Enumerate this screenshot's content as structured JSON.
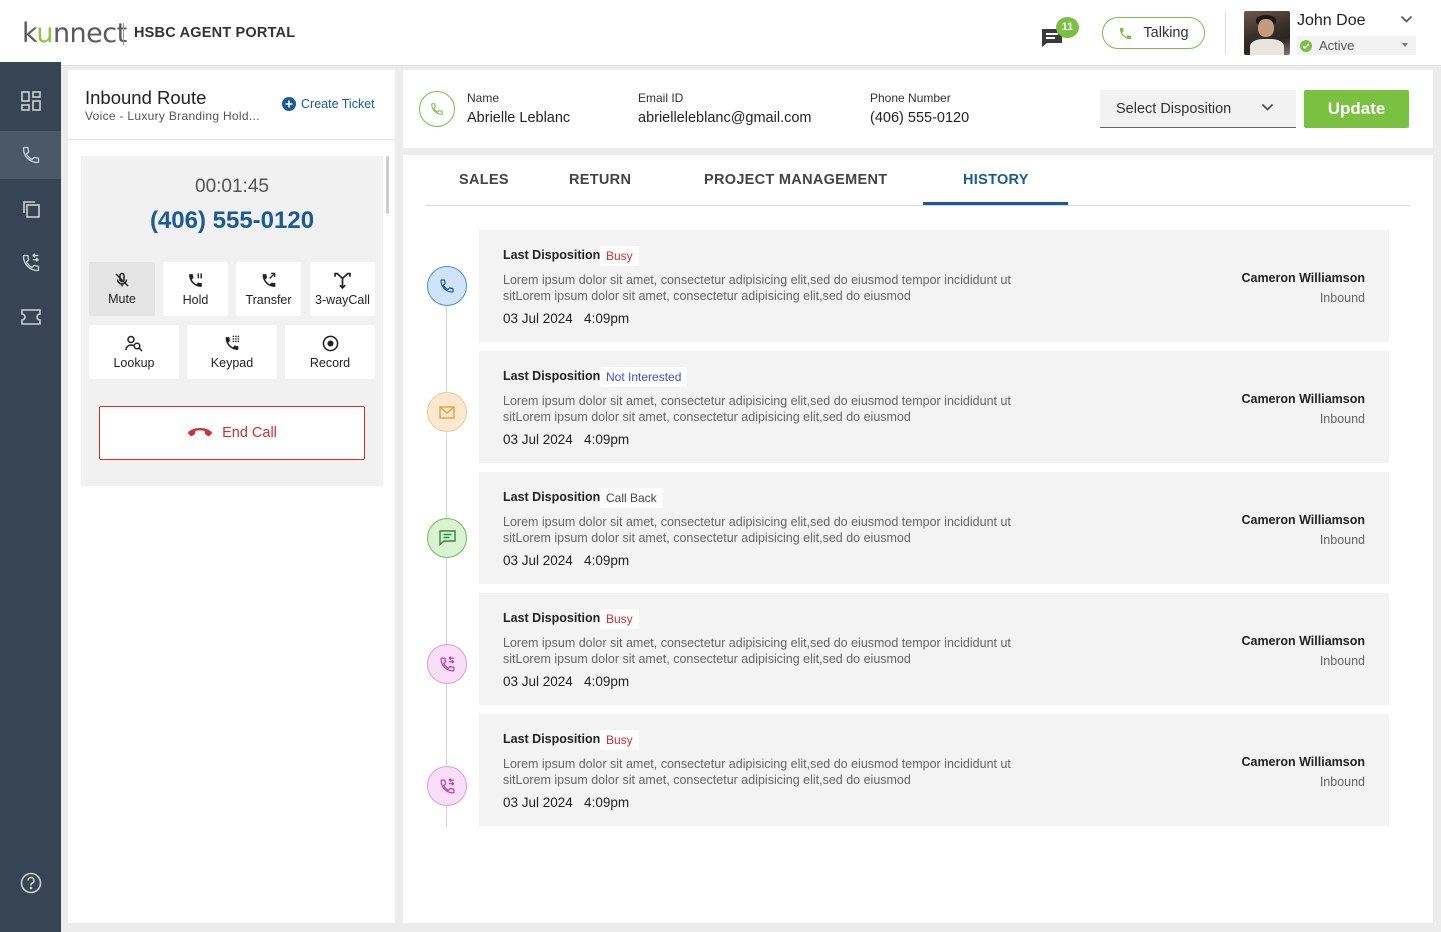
{
  "header": {
    "logo_pre": "k",
    "logo_u": "u",
    "logo_post": "nnect",
    "portal_title": "HSBC AGENT PORTAL",
    "chat_count": "11",
    "talking_label": "Talking",
    "user_name": "John Doe",
    "user_status": "Active"
  },
  "sidebar": {
    "items": [
      {
        "icon": "dashboard-icon"
      },
      {
        "icon": "phone-icon",
        "active": true
      },
      {
        "icon": "copy-icon"
      },
      {
        "icon": "call-transfer-icon"
      },
      {
        "icon": "ticket-icon"
      }
    ],
    "help_icon": "help-icon"
  },
  "left_panel": {
    "route_title": "Inbound Route",
    "route_subtitle": "Voice - Luxury Branding Hold...",
    "create_ticket": "Create Ticket",
    "timer": "00:01:45",
    "phone_number": "(406) 555-0120",
    "controls": {
      "mute": "Mute",
      "hold": "Hold",
      "transfer": "Transfer",
      "three_way": "3-wayCall",
      "lookup": "Lookup",
      "keypad": "Keypad",
      "record": "Record"
    },
    "end_call": "End Call"
  },
  "contact": {
    "name_label": "Name",
    "name": "Abrielle Leblanc",
    "email_label": "Email ID",
    "email": "abrielleleblanc@gmail.com",
    "phone_label": "Phone Number",
    "phone": "(406) 555-0120",
    "disposition_placeholder": "Select Disposition",
    "update_label": "Update"
  },
  "tabs": [
    "SALES",
    "RETURN",
    "PROJECT MANAGEMENT",
    "HISTORY"
  ],
  "active_tab": "HISTORY",
  "colors": {
    "accent_green": "#7ac142",
    "brand_blue": "#1a5a99",
    "busy_red": "#d62e2e",
    "sidebar_bg": "#374453"
  },
  "history": [
    {
      "label": "Last Disposition:",
      "disposition": "Busy",
      "disposition_color": "#d62e2e",
      "text": "Lorem ipsum dolor sit amet, consectetur adipisicing elit,sed do eiusmod tempor incididunt ut sitLorem ipsum dolor sit amet, consectetur adipisicing elit,sed do eiusmod",
      "date": "03 Jul 2024   4:09pm",
      "agent": "Cameron Williamson",
      "direction": "Inbound",
      "icon": "phone-icon"
    },
    {
      "label": "Last Disposition:",
      "disposition": "Not Interested",
      "disposition_color": "#3b4fd0",
      "text": "Lorem ipsum dolor sit amet, consectetur adipisicing elit,sed do eiusmod tempor incididunt ut sitLorem ipsum dolor sit amet, consectetur adipisicing elit,sed do eiusmod",
      "date": "03 Jul 2024   4:09pm",
      "agent": "Cameron Williamson",
      "direction": "Inbound",
      "icon": "mail-icon"
    },
    {
      "label": "Last Disposition:",
      "disposition": "Call Back",
      "disposition_color": "#444444",
      "text": "Lorem ipsum dolor sit amet, consectetur adipisicing elit,sed do eiusmod tempor incididunt ut sitLorem ipsum dolor sit amet, consectetur adipisicing elit,sed do eiusmod",
      "date": "03 Jul 2024   4:09pm",
      "agent": "Cameron Williamson",
      "direction": "Inbound",
      "icon": "chat-icon"
    },
    {
      "label": "Last Disposition:",
      "disposition": "Busy",
      "disposition_color": "#d62e2e",
      "text": "Lorem ipsum dolor sit amet, consectetur adipisicing elit,sed do eiusmod tempor incididunt ut sitLorem ipsum dolor sit amet, consectetur adipisicing elit,sed do eiusmod",
      "date": "03 Jul 2024   4:09pm",
      "agent": "Cameron Williamson",
      "direction": "Inbound",
      "icon": "call-transfer-icon"
    },
    {
      "label": "Last Disposition:",
      "disposition": "Busy",
      "disposition_color": "#d62e2e",
      "text": "Lorem ipsum dolor sit amet, consectetur adipisicing elit,sed do eiusmod tempor incididunt ut sitLorem ipsum dolor sit amet, consectetur adipisicing elit,sed do eiusmod",
      "date": "03 Jul 2024   4:09pm",
      "agent": "Cameron Williamson",
      "direction": "Inbound",
      "icon": "call-transfer-icon"
    }
  ]
}
